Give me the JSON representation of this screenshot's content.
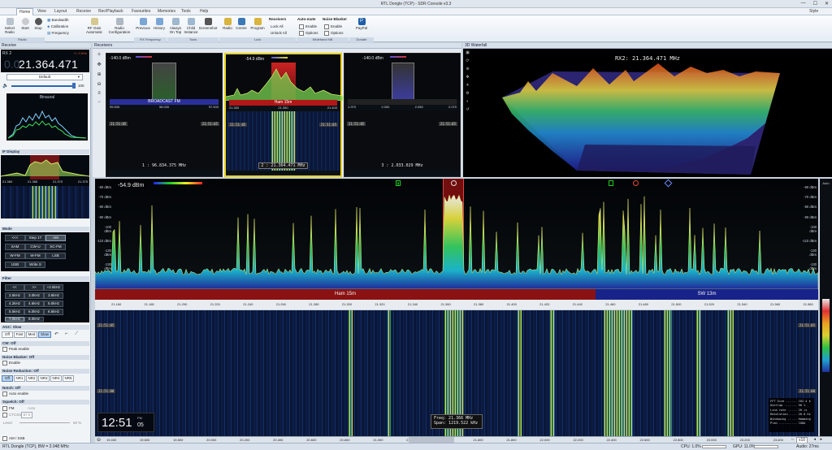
{
  "window": {
    "title": "RTL Dongle (TCP) - SDR Console v3.3",
    "minimize": "—",
    "maximize": "☐",
    "close": "✕",
    "style": "Style"
  },
  "tabs": [
    "Home",
    "View",
    "Layout",
    "Receive",
    "Rec/Playback",
    "Favourites",
    "Memories",
    "Tools",
    "Help"
  ],
  "ribbon": {
    "buttons": [
      {
        "label": "Select Radio",
        "icon": "radio-select-icon"
      },
      {
        "label": "Start",
        "icon": "play-icon"
      },
      {
        "label": "Stop",
        "icon": "stop-icon"
      },
      {
        "label": "Bandwidth",
        "icon": "bandwidth-icon"
      },
      {
        "label": "Calibration",
        "icon": "calibration-icon"
      },
      {
        "label": "Frequency",
        "icon": "frequency-icon"
      },
      {
        "label": "RF Gain Automatic",
        "icon": "rf-gain-icon"
      },
      {
        "label": "Radio Configuration",
        "icon": "radio-config-icon"
      },
      {
        "label": "Previous",
        "icon": "previous-icon"
      },
      {
        "label": "History",
        "icon": "history-icon"
      },
      {
        "label": "Always On Top",
        "icon": "pin-icon"
      },
      {
        "label": "Child Instance",
        "icon": "child-instance-icon"
      },
      {
        "label": "Screenshot",
        "icon": "camera-icon"
      },
      {
        "label": "Radio",
        "icon": "lock-radio-icon"
      },
      {
        "label": "Centre",
        "icon": "lock-centre-icon"
      },
      {
        "label": "Program",
        "icon": "lock-program-icon"
      },
      {
        "label": "PayPal",
        "icon": "paypal-icon"
      }
    ],
    "receivers": {
      "title": "Receivers",
      "lock_all": "Lock All",
      "unlock_all": "Unlock All"
    },
    "auto_mute": {
      "title": "Auto-mute",
      "enable": "Enable",
      "options": "Options"
    },
    "noise_blanker": {
      "title": "Noise Blanker",
      "enable": "Enable",
      "options": "Options"
    },
    "groups": [
      "Radio",
      "RX Frequency",
      "Tools",
      "Lock",
      "Wideband NB",
      "Donate"
    ]
  },
  "receive_panel": {
    "title": "Receive",
    "rx_label": "RX 2",
    "smeter": "+/- 0.0Hz",
    "frequency_dim": "0.0",
    "frequency": "21.364.471",
    "preset": "Default",
    "volume": "100",
    "spectrum_label": "Binaural",
    "if_display_title": "IF Display",
    "if_ticks": [
      "21.360",
      "21.365",
      "21.370",
      "21.375"
    ],
    "mode_title": "Mode",
    "modes": [
      "<<<",
      "Step 1T",
      "AM",
      "SAM",
      "CW-U",
      "SC-FM",
      "W-FM",
      "W-FM",
      "LSB",
      "USB",
      "Write S"
    ],
    "filter_title": "Filter",
    "filters": [
      "<<",
      ">>",
      "+2.5kHz",
      "2.5kHz",
      "3.0kHz",
      "3.6kHz",
      "4.2kHz",
      "4.6kHz",
      "5.0kHz",
      "5.5kHz",
      "6.0kHz",
      "6.5kHz",
      "7.0kHz",
      "8.0kHz"
    ],
    "agc_title": "AGC: Slow",
    "agc_options": [
      "Off",
      "Fast",
      "Med",
      "Slow"
    ],
    "cw_title": "CW: Off",
    "cw_peak": "Peak enable",
    "nb_title": "Noise Blanker: Off",
    "nb_enable": "Enable",
    "nr_title": "Noise Reduction: Off",
    "nr_options": [
      "Off",
      "NR1",
      "NR2",
      "NR3",
      "NR4",
      "NR5"
    ],
    "notch_title": "Notch: Off",
    "notch_auto": "Auto enable",
    "squelch_title": "Squelch: Off",
    "squelch_fm": "FM",
    "squelch_auto": "Auto",
    "ctcss": "CTCSS",
    "ctcss_value": "67.0",
    "ctcss_unit": "Level",
    "squelch_level": "50 %",
    "am_ssb": "AM / SSB"
  },
  "receivers_panel": {
    "title": "Receivers",
    "rx": [
      {
        "level": "-140.0 dBm",
        "band": "BROADCAST FM",
        "ticks": [
          "95.500",
          "96.000",
          "97.000"
        ],
        "time_l": "21:51:05",
        "time_r": "21:51:05",
        "freq": "1 : 96.834.375 MHz"
      },
      {
        "level": "-54.9 dBm",
        "band": "Ham 15m",
        "ticks": [
          "21.300",
          "21.350",
          "21.400"
        ],
        "time_l": "21:51:05",
        "time_r": "21:51:05",
        "freq": "2 : 21.364.471 MHz"
      },
      {
        "level": "-140.0 dBm",
        "band": "",
        "ticks": [
          "1.970",
          "2.000",
          "2.050",
          "2.070"
        ],
        "time_l": "21:51:05",
        "time_r": "21:51:05",
        "freq": "3 : 2.033.029 MHz"
      }
    ]
  },
  "waterfall3d": {
    "title": "3D Waterfall",
    "label": "RX2: 21.364.471 MHz"
  },
  "spectrum": {
    "level": "-54.9 dBm",
    "scale_left": [
      "-60 dBm",
      "-70 dBm",
      "-80 dBm",
      "-90 dBm",
      "-100 dBm",
      "-110 dBm",
      "-120 dBm",
      "-130 dBm",
      "-140 dBm",
      "-150 dBm"
    ],
    "scale_right": [
      "-60 dBm",
      "-70 dBm",
      "-80 dBm",
      "-90 dBm",
      "-100 dBm",
      "-110 dBm",
      "-120 dBm",
      "-130 dBm",
      "-140 dBm",
      "-150 dBm"
    ],
    "band_left": "Ham 15m",
    "band_right": "SW 13m",
    "ticks": [
      "21.160",
      "21.180",
      "21.200",
      "21.220",
      "21.240",
      "21.260",
      "21.280",
      "21.300",
      "21.320",
      "21.340",
      "21.360",
      "21.380",
      "21.400",
      "21.420",
      "21.440",
      "21.460",
      "21.480",
      "21.500",
      "21.520",
      "21.540",
      "21.560",
      "21.580"
    ],
    "auto": "Auto"
  },
  "waterfall": {
    "time_top_l": "21:51:05",
    "time_top_r": "21:51:05",
    "time_bot_l": "21:51:00",
    "time_bot_r": "21:51:00",
    "clock": "12:51",
    "clock_sec": "05",
    "clock_ampm": "PM",
    "freq_label": "Freq:  21.366 MHz",
    "span_label": "Span: 1219.522 kHz",
    "info": [
      "FFT Size ...... 102.4 k",
      "Overlap ....... 50 %",
      "Line rate ..... 20 /s",
      "Resolution .... 20.0 Hz",
      "Windowing ..... Hamming",
      "Plan .......... CUDA"
    ],
    "ticks": [
      "19.400",
      "19.600",
      "19.800",
      "20.000",
      "20.200",
      "20.400",
      "20.600",
      "20.800",
      "21.000",
      "21.200",
      "21.400",
      "21.600",
      "21.800",
      "22.000",
      "22.200",
      "22.400",
      "22.600",
      "22.800",
      "23.000",
      "23.200",
      "23.400"
    ],
    "zoom": "x10"
  },
  "status": {
    "left": "RTL Dongle (TCP), BW = 2.048 MHz",
    "cpu": "CPU: 1.0%",
    "gpu": "GPU: 11.0%",
    "audio": "Audio: 27ms"
  }
}
